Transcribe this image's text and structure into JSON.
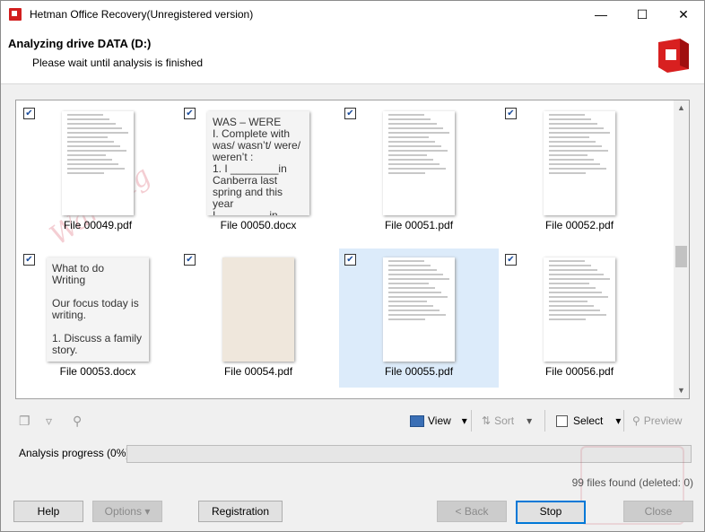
{
  "window": {
    "title": "Hetman Office Recovery(Unregistered version)"
  },
  "header": {
    "title": "Analyzing drive DATA (D:)",
    "subtitle": "Please wait until analysis is finished"
  },
  "watermark": "Warning",
  "files": [
    {
      "name": "File 00049.pdf",
      "type": "pdf",
      "checked": true,
      "selected": false
    },
    {
      "name": "File 00050.docx",
      "type": "docx",
      "checked": true,
      "selected": false,
      "preview": "WAS – WERE\nI. Complete with was/ wasn’t/ were/ weren’t :\n1. I ________in Canberra last spring and this year\nI ________ in"
    },
    {
      "name": "File 00051.pdf",
      "type": "pdf",
      "checked": true,
      "selected": false
    },
    {
      "name": "File 00052.pdf",
      "type": "pdf",
      "checked": true,
      "selected": false
    },
    {
      "name": "File 00053.docx",
      "type": "docx",
      "checked": true,
      "selected": false,
      "preview": "What to do\nWriting\n\nOur focus today is writing.\n\n1. Discuss a family story."
    },
    {
      "name": "File 00054.pdf",
      "type": "pdf",
      "checked": true,
      "selected": false
    },
    {
      "name": "File 00055.pdf",
      "type": "pdf",
      "checked": true,
      "selected": true
    },
    {
      "name": "File 00056.pdf",
      "type": "pdf",
      "checked": true,
      "selected": false
    }
  ],
  "toolbar": {
    "view": "View",
    "sort": "Sort",
    "select": "Select",
    "preview": "Preview"
  },
  "progress": {
    "label": "Analysis progress (0%)",
    "value": 0
  },
  "status": {
    "files_found": "99 files found (deleted: 0)"
  },
  "buttons": {
    "help": "Help",
    "options": "Options",
    "registration": "Registration",
    "back": "< Back",
    "stop": "Stop",
    "close": "Close"
  }
}
